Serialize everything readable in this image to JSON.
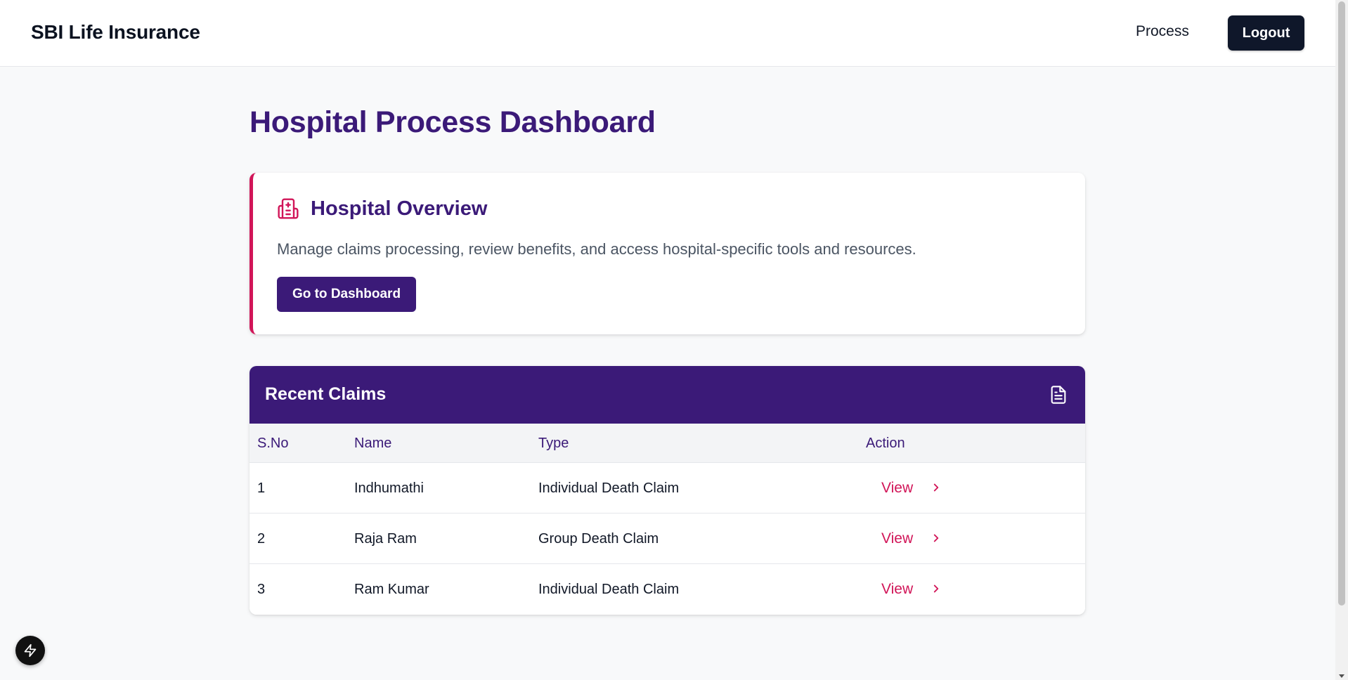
{
  "header": {
    "brand": "SBI Life Insurance",
    "nav_process": "Process",
    "logout_label": "Logout"
  },
  "page": {
    "title": "Hospital Process Dashboard"
  },
  "overview": {
    "icon": "hospital-icon",
    "title": "Hospital Overview",
    "description": "Manage claims processing, review benefits, and access hospital-specific tools and resources.",
    "button_label": "Go to Dashboard"
  },
  "claims": {
    "title": "Recent Claims",
    "header_icon": "document-icon",
    "columns": [
      "S.No",
      "Name",
      "Type",
      "Action"
    ],
    "rows": [
      {
        "sno": "1",
        "name": "Indhumathi",
        "type": "Individual Death Claim",
        "action": "View"
      },
      {
        "sno": "2",
        "name": "Raja Ram",
        "type": "Group Death Claim",
        "action": "View"
      },
      {
        "sno": "3",
        "name": "Ram Kumar",
        "type": "Individual Death Claim",
        "action": "View"
      }
    ]
  },
  "floating": {
    "icon": "bolt-icon"
  },
  "colors": {
    "primary": "#3b1a78",
    "accent": "#d11558",
    "dark": "#0f172a",
    "background": "#f8f9fa"
  }
}
